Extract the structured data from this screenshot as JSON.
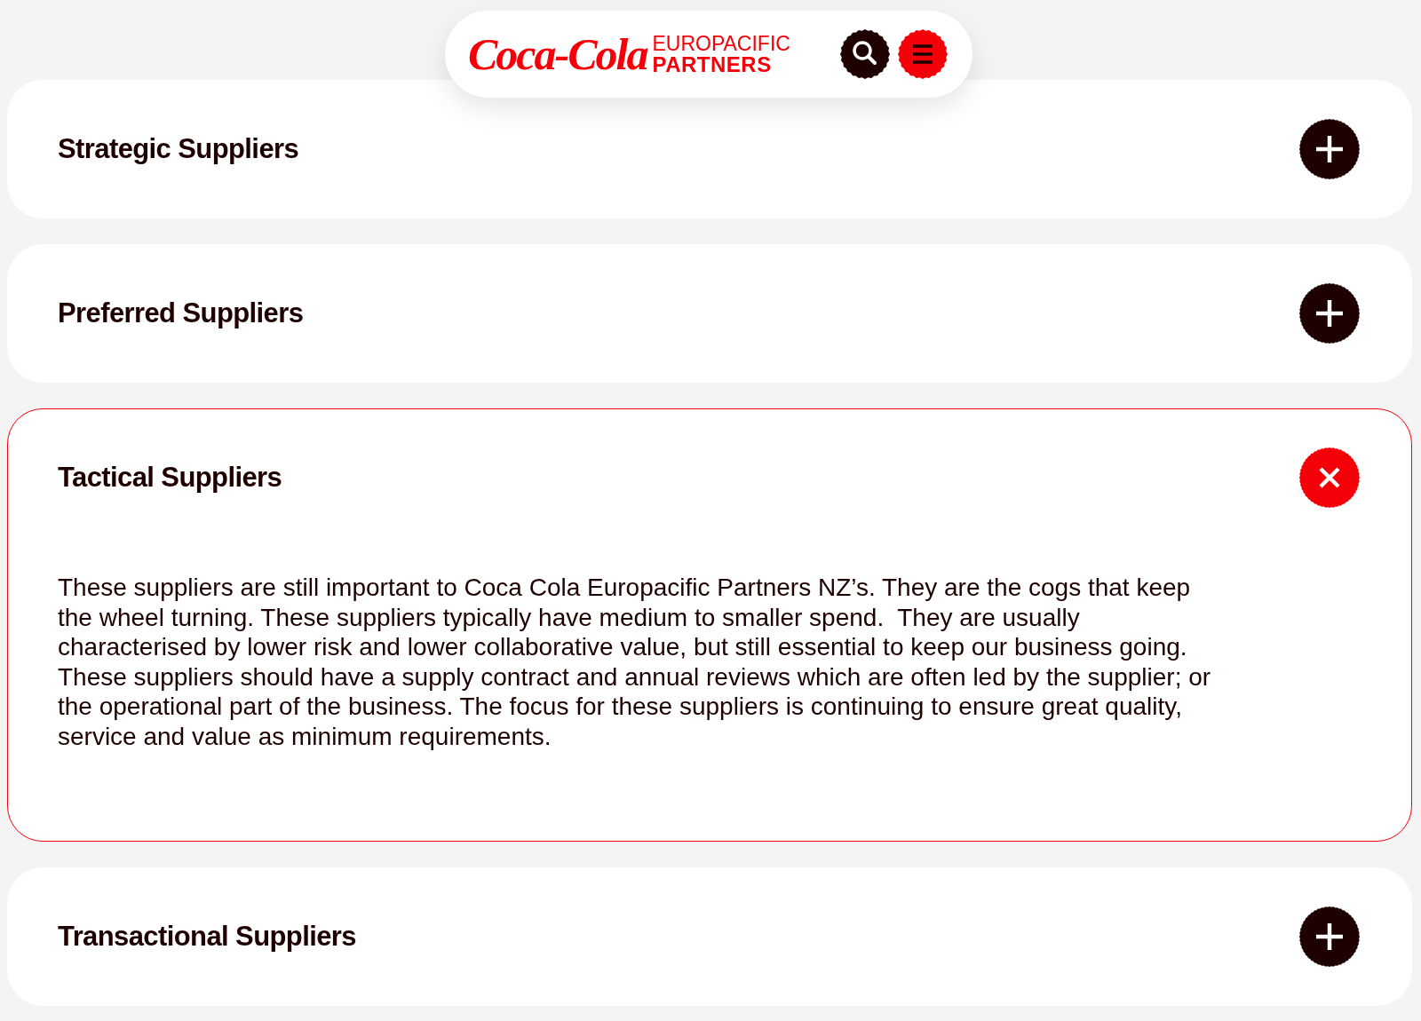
{
  "header": {
    "logo": {
      "script": "Coca-Cola",
      "line_1": "EUROPACIFIC",
      "line_2": "PARTNERS"
    }
  },
  "accordion": [
    {
      "title": "Strategic Suppliers",
      "expanded": false
    },
    {
      "title": "Preferred Suppliers",
      "expanded": false
    },
    {
      "title": "Tactical Suppliers",
      "expanded": true,
      "body": "These suppliers are still important to Coca Cola Europacific Partners NZ’s. They are the cogs that keep the wheel turning. These suppliers typically have medium to smaller spend.  They are usually characterised by lower risk and lower collaborative value, but still essential to keep our business going.  These suppliers should have a supply contract and annual reviews which are often led by the supplier; or the operational part of the business. The focus for these suppliers is continuing to ensure great quality, service and value as minimum requirements."
    },
    {
      "title": "Transactional Suppliers",
      "expanded": false
    }
  ]
}
